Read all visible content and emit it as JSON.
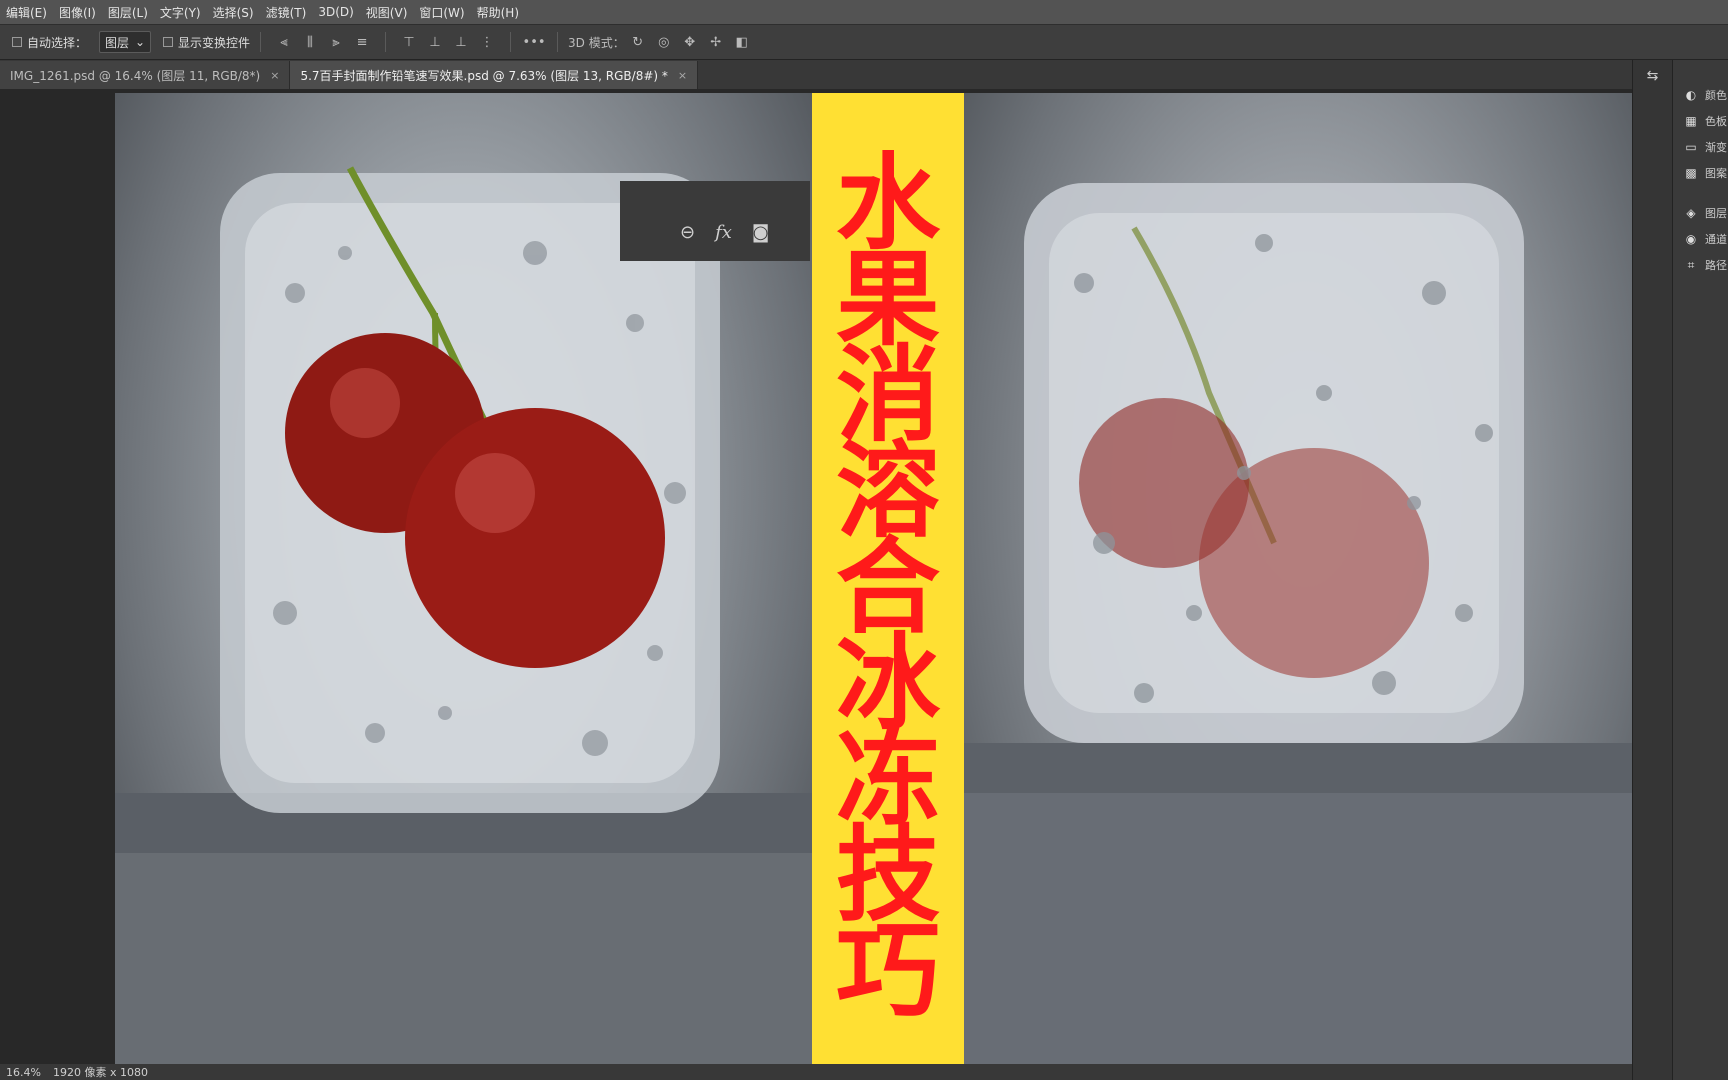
{
  "menu": [
    "编辑(E)",
    "图像(I)",
    "图层(L)",
    "文字(Y)",
    "选择(S)",
    "滤镜(T)",
    "3D(D)",
    "视图(V)",
    "窗口(W)",
    "帮助(H)"
  ],
  "options": {
    "auto_select_label": "自动选择：",
    "auto_select_value": "图层",
    "transform_controls_label": "显示变换控件",
    "mode_3d_label": "3D 模式："
  },
  "tabs": [
    {
      "label": "IMG_1261.psd @ 16.4% (图层 11, RGB/8*)",
      "close": "×"
    },
    {
      "label": "5.7百手封面制作铅笔速写效果.psd @ 7.63% (图层 13, RGB/8#) *",
      "close": "×"
    }
  ],
  "banner": {
    "title_chars": [
      "水",
      "果",
      "消",
      "溶",
      "合",
      "冰",
      "冻",
      "技",
      "巧"
    ],
    "bg": "#ffe033",
    "fg": "#ff1a1a"
  },
  "panels": [
    {
      "icon": "palette-icon",
      "label": "颜色"
    },
    {
      "icon": "swatches-icon",
      "label": "色板"
    },
    {
      "icon": "gradient-icon",
      "label": "渐变"
    },
    {
      "icon": "patterns-icon",
      "label": "图案"
    },
    {
      "icon": "layers-icon",
      "label": "图层"
    },
    {
      "icon": "channels-icon",
      "label": "通道"
    },
    {
      "icon": "paths-icon",
      "label": "路径"
    }
  ],
  "status": {
    "zoom": "16.4%",
    "dims": "1920 像素 x 1080"
  }
}
